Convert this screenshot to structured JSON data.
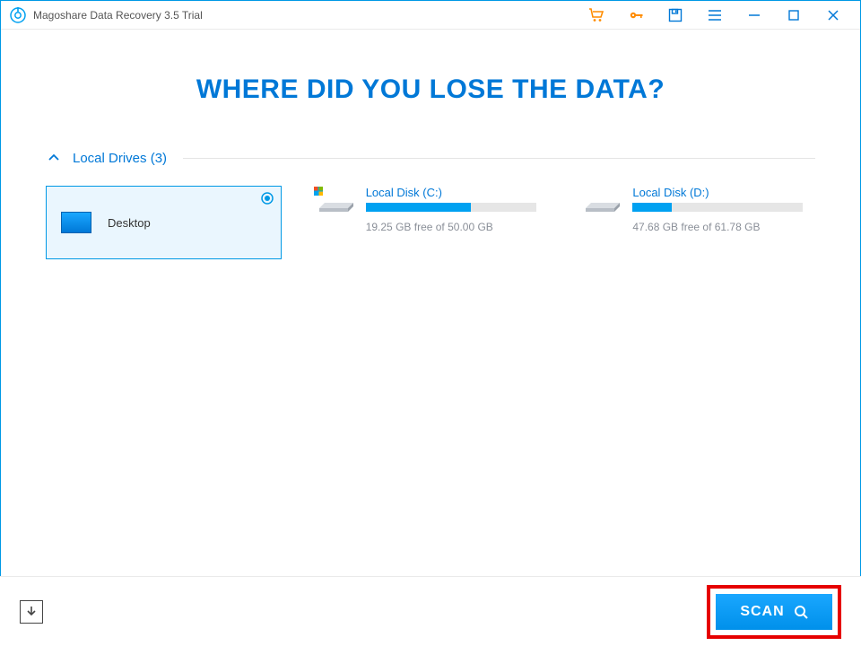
{
  "window": {
    "title": "Magoshare Data Recovery 3.5 Trial"
  },
  "titlebar_icons": {
    "cart": "cart-icon",
    "key": "key-icon",
    "save": "save-icon",
    "menu": "menu-icon",
    "minimize": "minimize-icon",
    "maximize": "maximize-icon",
    "close": "close-icon"
  },
  "headline": "WHERE DID YOU LOSE THE DATA?",
  "section": {
    "label": "Local Drives (3)",
    "count": 3
  },
  "drives": [
    {
      "id": "desktop",
      "label": "Desktop",
      "selected": true,
      "type": "location"
    },
    {
      "id": "c",
      "label": "Local Disk (C:)",
      "free_text": "19.25 GB free of 50.00 GB",
      "free_gb": 19.25,
      "total_gb": 50.0,
      "used_pct": 61.5,
      "type": "disk",
      "os_badge": true
    },
    {
      "id": "d",
      "label": "Local Disk (D:)",
      "free_text": "47.68 GB free of 61.78 GB",
      "free_gb": 47.68,
      "total_gb": 61.78,
      "used_pct": 22.8,
      "type": "disk",
      "os_badge": false
    }
  ],
  "footer": {
    "scan_label": "SCAN"
  }
}
